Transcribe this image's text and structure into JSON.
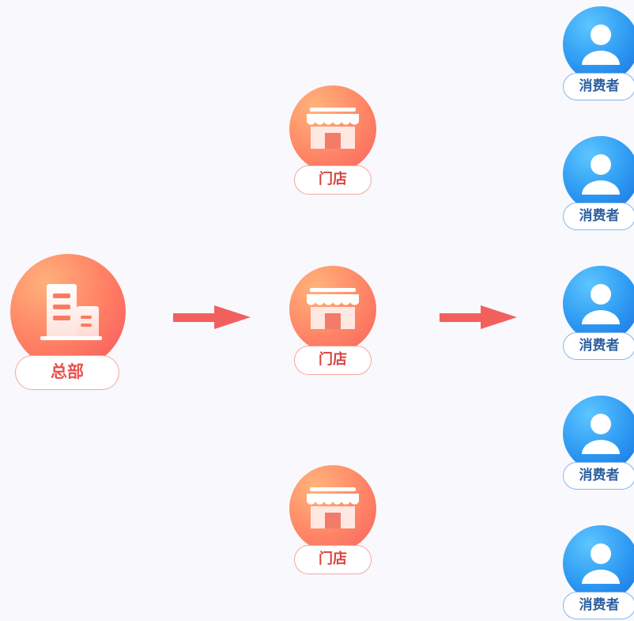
{
  "diagram": {
    "hq": {
      "label": "总部",
      "icon": "building-icon"
    },
    "stores": [
      {
        "label": "门店",
        "icon": "storefront-icon"
      },
      {
        "label": "门店",
        "icon": "storefront-icon"
      },
      {
        "label": "门店",
        "icon": "storefront-icon"
      }
    ],
    "consumers": [
      {
        "label": "消费者",
        "icon": "person-icon"
      },
      {
        "label": "消费者",
        "icon": "person-icon"
      },
      {
        "label": "消费者",
        "icon": "person-icon"
      },
      {
        "label": "消费者",
        "icon": "person-icon"
      },
      {
        "label": "消费者",
        "icon": "person-icon"
      }
    ]
  },
  "colors": {
    "background": "#f9f8fc",
    "hq_gradient": [
      "#ffb07a",
      "#f5545e"
    ],
    "store_gradient": [
      "#ffb37a",
      "#f7615f"
    ],
    "consumer_gradient": [
      "#5cc6ff",
      "#1a6fe0"
    ],
    "arrow": "#f2605e",
    "hq_text": "#e8524d",
    "store_text": "#d9443e",
    "consumer_text": "#2d5f9e"
  }
}
